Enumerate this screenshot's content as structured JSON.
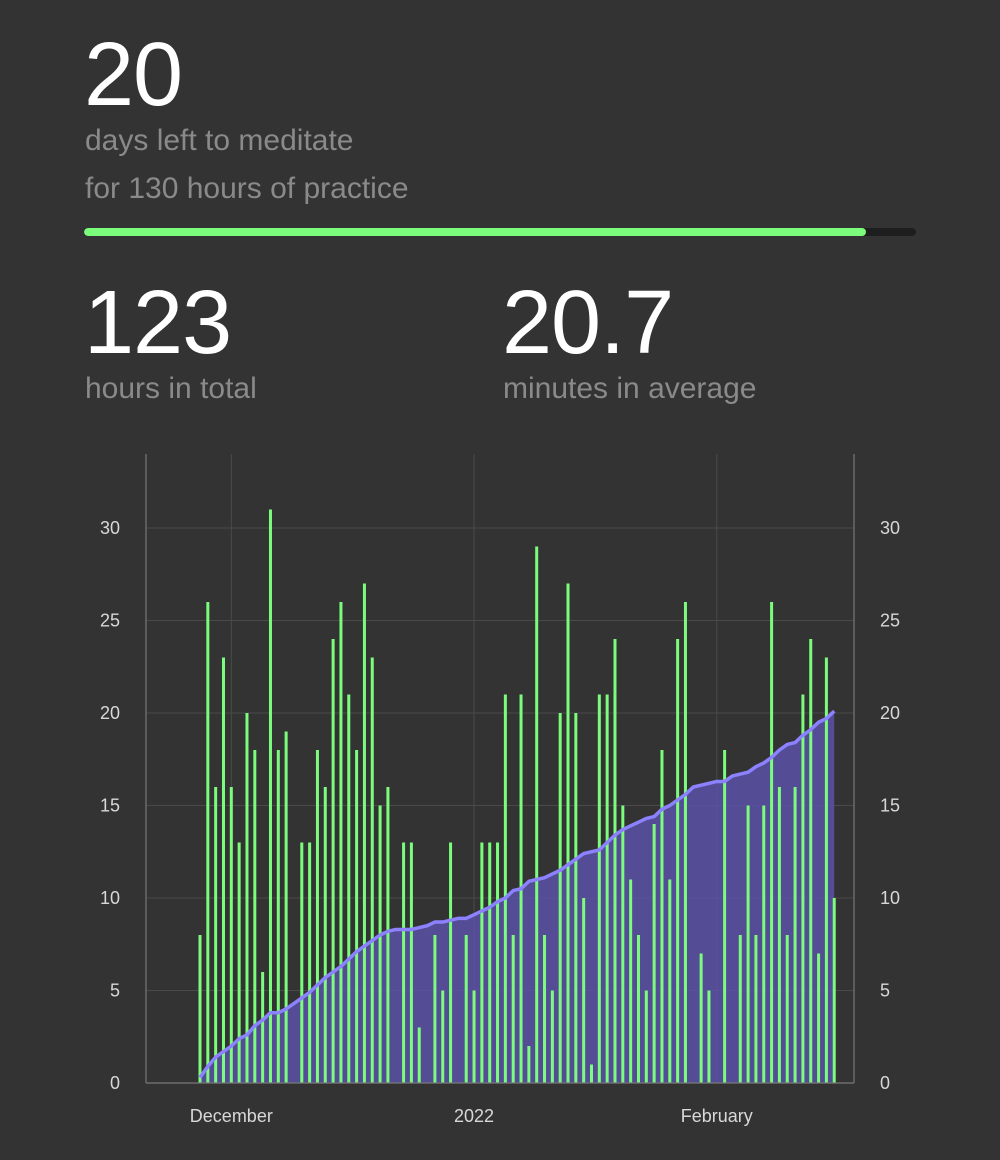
{
  "days_left": {
    "value": "20",
    "line1": "days left to meditate",
    "line2": "for 130 hours of practice"
  },
  "progress": {
    "fraction": 0.94,
    "color": "#7cfc7c",
    "track_color": "#1e1e1e"
  },
  "total": {
    "value": "123",
    "label": "hours in total"
  },
  "average": {
    "value": "20.7",
    "label": "minutes in average"
  },
  "chart_data": {
    "type": "bar",
    "title": "",
    "xlabel": "",
    "ylabel": "",
    "left_axis": {
      "ticks": [
        "0",
        "5",
        "10",
        "15",
        "20",
        "25",
        "30"
      ],
      "ylim": [
        0,
        34
      ]
    },
    "right_axis": {
      "ticks": [
        "0",
        "5",
        "10",
        "15",
        "20",
        "25",
        "30"
      ],
      "ylim": [
        0,
        34
      ]
    },
    "x_tick_labels": [
      "December",
      "2022",
      "February"
    ],
    "x_tick_day_index": [
      4,
      35,
      66
    ],
    "grid": true,
    "colors": {
      "bars": "#7cfc7c",
      "line": "#8c82ff",
      "area": "#5a52a8"
    },
    "series": [
      {
        "type": "bar",
        "axis": "left",
        "values": [
          8,
          26,
          16,
          23,
          16,
          13,
          20,
          18,
          6,
          31,
          18,
          19,
          0,
          13,
          13,
          18,
          16,
          24,
          26,
          21,
          18,
          27,
          23,
          15,
          16,
          0,
          13,
          13,
          3,
          0,
          8,
          5,
          13,
          0,
          8,
          5,
          13,
          13,
          13,
          21,
          8,
          21,
          2,
          29,
          8,
          5,
          20,
          27,
          20,
          10,
          1,
          21,
          21,
          24,
          15,
          11,
          8,
          5,
          14,
          18,
          11,
          24,
          26,
          0,
          7,
          5,
          0,
          18,
          0,
          8,
          15,
          8,
          15,
          26,
          16,
          8,
          16,
          21,
          24,
          7,
          23,
          10
        ]
      },
      {
        "type": "area-line",
        "axis": "right",
        "values": [
          0.3,
          0.9,
          1.4,
          1.7,
          2.0,
          2.4,
          2.6,
          3.1,
          3.4,
          3.8,
          3.8,
          4.0,
          4.3,
          4.6,
          4.9,
          5.3,
          5.7,
          6.0,
          6.3,
          6.7,
          7.1,
          7.4,
          7.7,
          8.0,
          8.2,
          8.3,
          8.3,
          8.3,
          8.4,
          8.5,
          8.7,
          8.7,
          8.8,
          8.9,
          8.9,
          9.1,
          9.3,
          9.5,
          9.8,
          10.0,
          10.4,
          10.5,
          10.9,
          11.0,
          11.1,
          11.3,
          11.5,
          11.8,
          12.1,
          12.4,
          12.5,
          12.6,
          13.0,
          13.4,
          13.7,
          13.9,
          14.1,
          14.3,
          14.4,
          14.8,
          15.0,
          15.3,
          15.6,
          16.0,
          16.1,
          16.2,
          16.3,
          16.3,
          16.6,
          16.7,
          16.8,
          17.1,
          17.3,
          17.6,
          18.0,
          18.3,
          18.4,
          18.8,
          19.1,
          19.5,
          19.7,
          20.1
        ]
      }
    ]
  }
}
